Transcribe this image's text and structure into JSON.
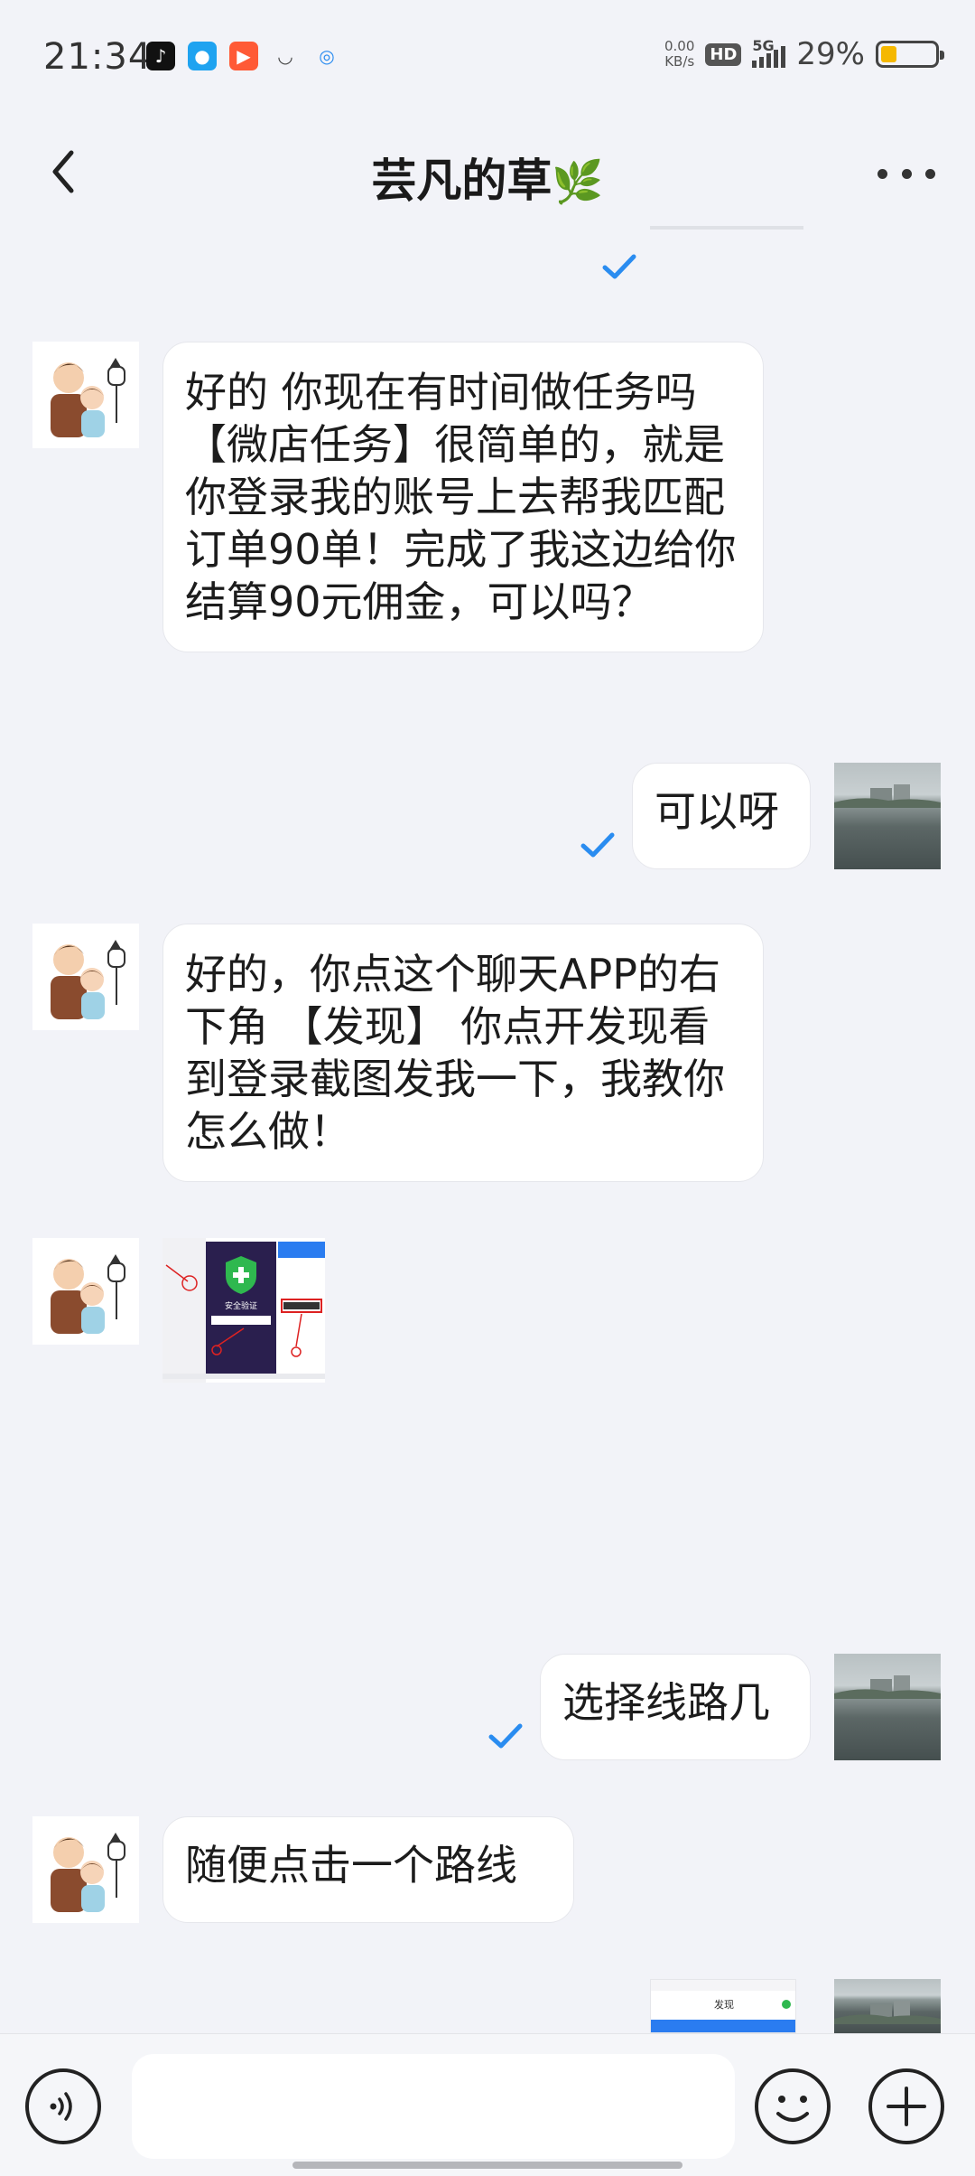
{
  "status_bar": {
    "time": "21:34",
    "net_speed_value": "0.00",
    "net_speed_unit": "KB/s",
    "hd": "HD",
    "network": "5G",
    "battery_percent": "29%",
    "battery_level": 0.29,
    "app_icons": [
      "douyin-icon",
      "qq-icon",
      "kuaishou-icon",
      "cup-icon",
      "browser-icon"
    ]
  },
  "header": {
    "title": "芸凡的草",
    "title_emoji": "🌿"
  },
  "messages": [
    {
      "side": "left",
      "type": "text",
      "text": "好的 你现在有时间做任务吗【微店任务】很简单的，就是你登录我的账号上去帮我匹配订单90单！完成了我这边给你结算90元佣金，可以吗？"
    },
    {
      "side": "right",
      "type": "text",
      "text": "可以呀",
      "read": true
    },
    {
      "side": "left",
      "type": "text",
      "text": "好的，你点这个聊天APP的右下角 【发现】 你点开发现看到登录截图发我一下，我教你怎么做！"
    },
    {
      "side": "left",
      "type": "image",
      "shield_text": "安全验证"
    },
    {
      "side": "right",
      "type": "text",
      "text": "选择线路几",
      "read": true
    },
    {
      "side": "left",
      "type": "text",
      "text": "随便点击一个路线"
    },
    {
      "side": "right",
      "type": "image",
      "caption": "发现"
    }
  ],
  "input": {
    "placeholder": ""
  },
  "colors": {
    "background": "#f2f3f8",
    "bubble": "#ffffff",
    "read_check": "#2a8cf0"
  }
}
